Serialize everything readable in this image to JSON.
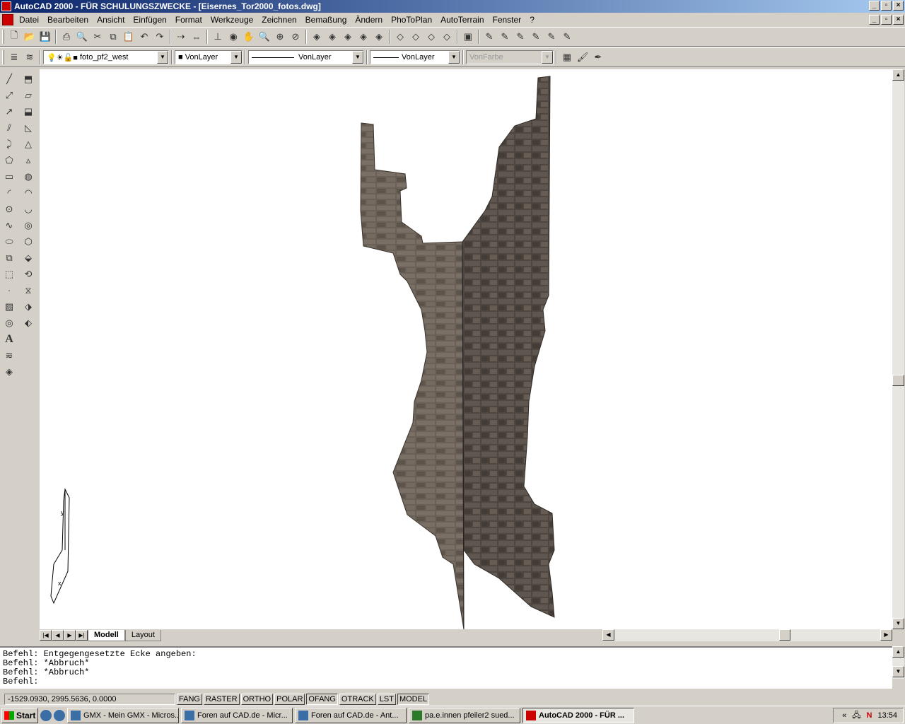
{
  "window": {
    "title": "AutoCAD 2000 - FÜR SCHULUNGSZWECKE - [Eisernes_Tor2000_fotos.dwg]"
  },
  "menu": [
    "Datei",
    "Bearbeiten",
    "Ansicht",
    "Einfügen",
    "Format",
    "Werkzeuge",
    "Zeichnen",
    "Bemaßung",
    "Ändern",
    "PhoToPlan",
    "AutoTerrain",
    "Fenster",
    "?"
  ],
  "props": {
    "layer": "foto_pf2_west",
    "color": "VonLayer",
    "linetype": "VonLayer",
    "lineweight": "VonLayer",
    "plotstyle": "VonFarbe"
  },
  "tabs": {
    "model": "Modell",
    "layout": "Layout"
  },
  "command": {
    "lines": [
      "Befehl: Entgegengesetzte Ecke angeben:",
      "Befehl: *Abbruch*",
      "Befehl: *Abbruch*"
    ],
    "prompt": "Befehl:"
  },
  "status": {
    "coords": "-1529.0930, 2995.5636, 0.0000",
    "buttons": [
      "FANG",
      "RASTER",
      "ORTHO",
      "POLAR",
      "OFANG",
      "OTRACK",
      "LST",
      "MODEL"
    ]
  },
  "taskbar": {
    "start": "Start",
    "tasks": [
      "GMX - Mein GMX - Micros...",
      "Foren auf CAD.de - Micr...",
      "Foren auf CAD.de - Ant...",
      "pa.e.innen pfeiler2 sued...",
      "AutoCAD 2000 - FÜR ..."
    ],
    "clock": "13:54"
  },
  "colors": {
    "title_start": "#0a246a",
    "title_end": "#a6caf0",
    "wall_dark": "#4e4640",
    "wall_mid": "#6e645a"
  }
}
